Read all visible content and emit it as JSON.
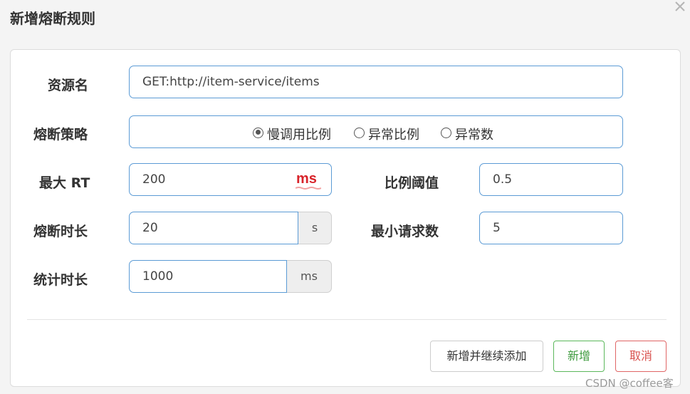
{
  "dialog": {
    "title": "新增熔断规则",
    "close_icon": "close-icon"
  },
  "form": {
    "resource": {
      "label": "资源名",
      "value": "GET:http://item-service/items"
    },
    "strategy": {
      "label": "熔断策略",
      "options": [
        {
          "label": "慢调用比例",
          "checked": true
        },
        {
          "label": "异常比例",
          "checked": false
        },
        {
          "label": "异常数",
          "checked": false
        }
      ]
    },
    "max_rt": {
      "label": "最大 RT",
      "value": "200",
      "unit_mark": "ms",
      "unit_mark_color": "#d8232a"
    },
    "ratio_threshold": {
      "label": "比例阈值",
      "value": "0.5"
    },
    "break_duration": {
      "label": "熔断时长",
      "value": "20",
      "unit": "s"
    },
    "min_requests": {
      "label": "最小请求数",
      "value": "5"
    },
    "stat_duration": {
      "label": "统计时长",
      "value": "1000",
      "unit": "ms"
    }
  },
  "buttons": {
    "add_continue": "新增并继续添加",
    "add": "新增",
    "cancel": "取消"
  },
  "colors": {
    "input_border": "#5b9bd5",
    "add_green": "#5cb85c",
    "cancel_red": "#d9534f"
  },
  "watermark": "CSDN @coffee客"
}
